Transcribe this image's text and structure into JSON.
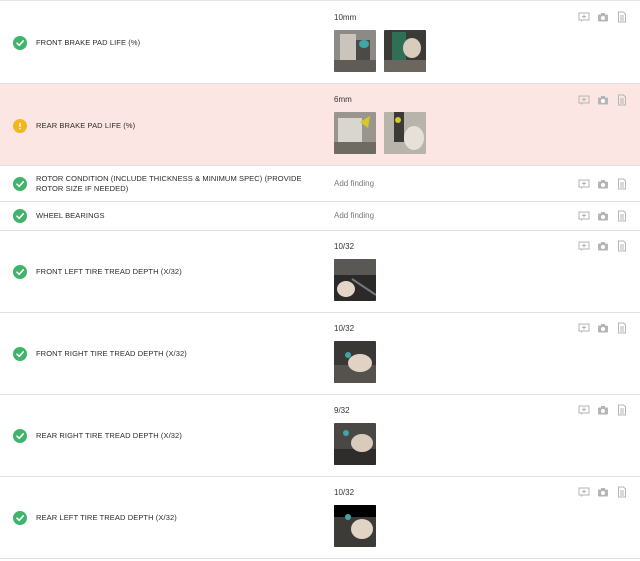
{
  "items": [
    {
      "label": "FRONT BRAKE PAD LIFE (%)",
      "status": "ok",
      "value": "10mm",
      "photos": 2
    },
    {
      "label": "REAR BRAKE PAD LIFE (%)",
      "status": "warning",
      "value": "6mm",
      "photos": 2
    },
    {
      "label": "ROTOR CONDITION (INCLUDE THICKNESS & MINIMUM SPEC) (PROVIDE ROTOR SIZE IF NEEDED)",
      "status": "ok",
      "value": "Add finding",
      "photos": 0
    },
    {
      "label": "WHEEL BEARINGS",
      "status": "ok",
      "value": "Add finding",
      "photos": 0
    },
    {
      "label": "FRONT LEFT TIRE TREAD DEPTH (x/32)",
      "status": "ok",
      "value": "10/32",
      "photos": 1
    },
    {
      "label": "FRONT RIGHT TIRE TREAD DEPTH (x/32)",
      "status": "ok",
      "value": "10/32",
      "photos": 1
    },
    {
      "label": "REAR RIGHT TIRE TREAD DEPTH (x/32)",
      "status": "ok",
      "value": "9/32",
      "photos": 1
    },
    {
      "label": "REAR LEFT TIRE TREAD DEPTH (x/32)",
      "status": "ok",
      "value": "10/32",
      "photos": 1
    }
  ],
  "actions": [
    "comment-icon",
    "camera-icon",
    "document-icon"
  ],
  "colors": {
    "ok": "#3fb46a",
    "warning": "#f4b61f",
    "warning_row_bg": "#fbe6e3"
  }
}
